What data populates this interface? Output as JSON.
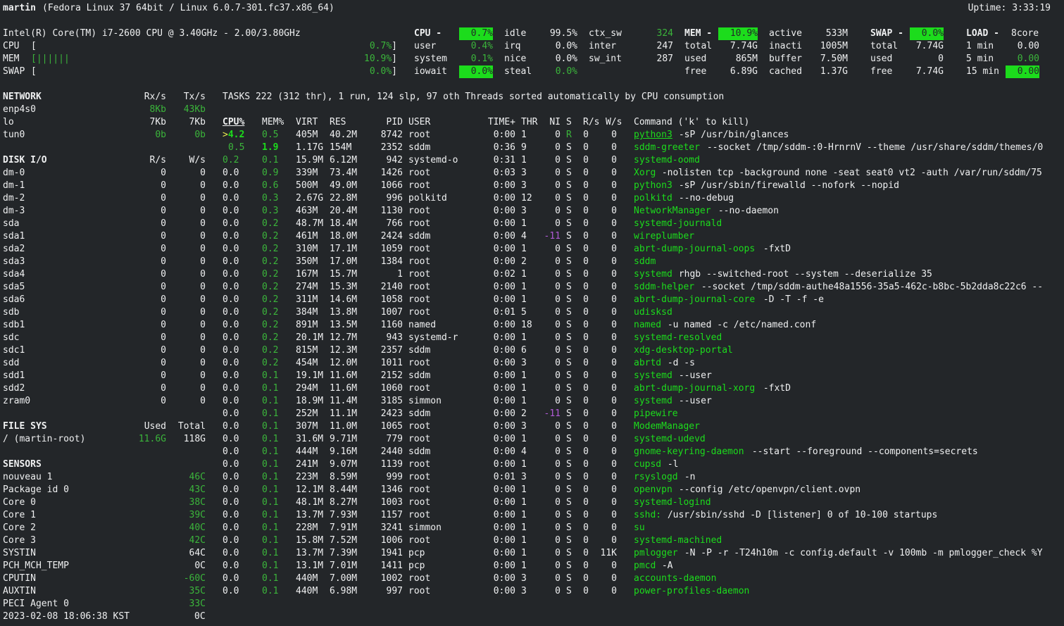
{
  "header": {
    "host": "martin",
    "sysinfo": "(Fedora Linux 37 64bit / Linux 6.0.7-301.fc37.x86_64)",
    "uptime": "Uptime: 3:33:19"
  },
  "quicklook": {
    "cpu_name": "Intel(R) Core(TM) i7-2600 CPU @ 3.40GHz - 2.00/3.80GHz",
    "bars": [
      {
        "label": "CPU",
        "bar": "[",
        "value": "0.7%]",
        "fraction": 0.007
      },
      {
        "label": "MEM",
        "bar": "[||||||",
        "value": "10.9%]",
        "fraction": 0.109
      },
      {
        "label": "SWAP",
        "bar": "[",
        "value": "0.0%]",
        "fraction": 0.0
      }
    ]
  },
  "cpu": {
    "title": "CPU -",
    "total": "0.7%",
    "rows": [
      {
        "k": "user",
        "v": "0.4%"
      },
      {
        "k": "system",
        "v": "0.1%"
      },
      {
        "k": "iowait",
        "v": "0.0%"
      }
    ],
    "rows2": [
      {
        "k": "idle",
        "v": "99.5%"
      },
      {
        "k": "irq",
        "v": "0.0%"
      },
      {
        "k": "nice",
        "v": "0.0%"
      },
      {
        "k": "steal",
        "v": "0.0%"
      }
    ],
    "rows3": [
      {
        "k": "ctx_sw",
        "v": "324"
      },
      {
        "k": "inter",
        "v": "247"
      },
      {
        "k": "sw_int",
        "v": "287"
      }
    ]
  },
  "mem": {
    "title": "MEM -",
    "total": "10.9%",
    "rows": [
      {
        "k": "total",
        "v": "7.74G"
      },
      {
        "k": "used",
        "v": "865M"
      },
      {
        "k": "free",
        "v": "6.89G"
      }
    ],
    "rows2": [
      {
        "k": "active",
        "v": "533M"
      },
      {
        "k": "inacti",
        "v": "1005M"
      },
      {
        "k": "buffer",
        "v": "7.50M"
      },
      {
        "k": "cached",
        "v": "1.37G"
      }
    ]
  },
  "swap": {
    "title": "SWAP -",
    "total": "0.0%",
    "rows": [
      {
        "k": "total",
        "v": "7.74G"
      },
      {
        "k": "used",
        "v": "0"
      },
      {
        "k": "free",
        "v": "7.74G"
      }
    ]
  },
  "load": {
    "title": "LOAD -",
    "cores": "8core",
    "rows": [
      {
        "k": "1 min",
        "v": "0.00"
      },
      {
        "k": "5 min",
        "v": "0.00"
      },
      {
        "k": "15 min",
        "v": "0.00"
      }
    ]
  },
  "network": {
    "title": "NETWORK",
    "rx": "Rx/s",
    "tx": "Tx/s",
    "rows": [
      {
        "name": "enp4s0",
        "rx": "8Kb",
        "tx": "43Kb"
      },
      {
        "name": "lo",
        "rx": "7Kb",
        "tx": "7Kb"
      },
      {
        "name": "tun0",
        "rx": "0b",
        "tx": "0b"
      }
    ]
  },
  "diskio": {
    "title": "DISK I/O",
    "r": "R/s",
    "w": "W/s",
    "rows": [
      {
        "name": "dm-0",
        "r": "0",
        "w": "0"
      },
      {
        "name": "dm-1",
        "r": "0",
        "w": "0"
      },
      {
        "name": "dm-2",
        "r": "0",
        "w": "0"
      },
      {
        "name": "dm-3",
        "r": "0",
        "w": "0"
      },
      {
        "name": "sda",
        "r": "0",
        "w": "0"
      },
      {
        "name": "sda1",
        "r": "0",
        "w": "0"
      },
      {
        "name": "sda2",
        "r": "0",
        "w": "0"
      },
      {
        "name": "sda3",
        "r": "0",
        "w": "0"
      },
      {
        "name": "sda4",
        "r": "0",
        "w": "0"
      },
      {
        "name": "sda5",
        "r": "0",
        "w": "0"
      },
      {
        "name": "sda6",
        "r": "0",
        "w": "0"
      },
      {
        "name": "sdb",
        "r": "0",
        "w": "0"
      },
      {
        "name": "sdb1",
        "r": "0",
        "w": "0"
      },
      {
        "name": "sdc",
        "r": "0",
        "w": "0"
      },
      {
        "name": "sdc1",
        "r": "0",
        "w": "0"
      },
      {
        "name": "sdd",
        "r": "0",
        "w": "0"
      },
      {
        "name": "sdd1",
        "r": "0",
        "w": "0"
      },
      {
        "name": "sdd2",
        "r": "0",
        "w": "0"
      },
      {
        "name": "zram0",
        "r": "0",
        "w": "0"
      }
    ]
  },
  "filesys": {
    "title": "FILE SYS",
    "used": "Used",
    "total": "Total",
    "rows": [
      {
        "name": "/ (martin-root)",
        "used": "11.6G",
        "total": "118G"
      }
    ]
  },
  "sensors": {
    "title": "SENSORS",
    "rows": [
      {
        "name": "nouveau 1",
        "v": "46C",
        "green": true
      },
      {
        "name": "Package id 0",
        "v": "43C",
        "green": true
      },
      {
        "name": "Core 0",
        "v": "38C",
        "green": true
      },
      {
        "name": "Core 1",
        "v": "39C",
        "green": true
      },
      {
        "name": "Core 2",
        "v": "40C",
        "green": true
      },
      {
        "name": "Core 3",
        "v": "42C",
        "green": true
      },
      {
        "name": "SYSTIN",
        "v": "64C",
        "green": false
      },
      {
        "name": "PCH_MCH_TEMP",
        "v": "0C",
        "green": false
      },
      {
        "name": "CPUTIN",
        "v": "-60C",
        "green": true
      },
      {
        "name": "AUXTIN",
        "v": "35C",
        "green": true
      },
      {
        "name": "PECI Agent 0",
        "v": "33C",
        "green": true
      }
    ]
  },
  "datetime": "2023-02-08 18:06:38 KST",
  "tasks": {
    "summary": "TASKS 222 (312 thr), 1 run, 124 slp, 97 oth Threads sorted automatically by CPU consumption",
    "headers": {
      "cpu": "CPU%",
      "mem": "MEM%",
      "virt": "VIRT",
      "res": "RES",
      "pid": "PID",
      "user": "USER",
      "time": "TIME+",
      "thr": "THR",
      "ni": "NI",
      "s": "S",
      "rs": "R/s",
      "ws": "W/s",
      "cmd": "Command ('k' to kill)"
    },
    "rows": [
      {
        "cpu": ">4.2",
        "mem": "0.5",
        "virt": "405M",
        "res": "40.2M",
        "pid": "8742",
        "user": "root",
        "time": "0:00",
        "thr": "1",
        "ni": "0",
        "s": "R",
        "r": "0",
        "w": "0",
        "name": "python3",
        "args": " -sP /usr/bin/glances"
      },
      {
        "cpu": "0.5",
        "mem": "1.9",
        "virt": "1.17G",
        "res": "154M",
        "pid": "2352",
        "user": "sddm",
        "time": "0:36",
        "thr": "9",
        "ni": "0",
        "s": "S",
        "r": "0",
        "w": "0",
        "name": "sddm-greeter",
        "args": " --socket /tmp/sddm-:0-HrnrnV --theme /usr/share/sddm/themes/0"
      },
      {
        "cpu": "0.2",
        "mem": "0.1",
        "virt": "15.9M",
        "res": "6.12M",
        "pid": "942",
        "user": "systemd-o",
        "time": "0:31",
        "thr": "1",
        "ni": "0",
        "s": "S",
        "r": "0",
        "w": "0",
        "name": "systemd-oomd",
        "args": ""
      },
      {
        "cpu": "0.0",
        "mem": "0.9",
        "virt": "339M",
        "res": "73.4M",
        "pid": "1426",
        "user": "root",
        "time": "0:03",
        "thr": "3",
        "ni": "0",
        "s": "S",
        "r": "0",
        "w": "0",
        "name": "Xorg",
        "args": " -nolisten tcp -background none -seat seat0 vt2 -auth /var/run/sddm/75"
      },
      {
        "cpu": "0.0",
        "mem": "0.6",
        "virt": "500M",
        "res": "49.0M",
        "pid": "1066",
        "user": "root",
        "time": "0:00",
        "thr": "3",
        "ni": "0",
        "s": "S",
        "r": "0",
        "w": "0",
        "name": "python3",
        "args": " -sP /usr/sbin/firewalld --nofork --nopid"
      },
      {
        "cpu": "0.0",
        "mem": "0.3",
        "virt": "2.67G",
        "res": "22.8M",
        "pid": "996",
        "user": "polkitd",
        "time": "0:00",
        "thr": "12",
        "ni": "0",
        "s": "S",
        "r": "0",
        "w": "0",
        "name": "polkitd",
        "args": " --no-debug"
      },
      {
        "cpu": "0.0",
        "mem": "0.3",
        "virt": "463M",
        "res": "20.4M",
        "pid": "1130",
        "user": "root",
        "time": "0:00",
        "thr": "3",
        "ni": "0",
        "s": "S",
        "r": "0",
        "w": "0",
        "name": "NetworkManager",
        "args": " --no-daemon"
      },
      {
        "cpu": "0.0",
        "mem": "0.2",
        "virt": "48.7M",
        "res": "18.4M",
        "pid": "766",
        "user": "root",
        "time": "0:00",
        "thr": "1",
        "ni": "0",
        "s": "S",
        "r": "0",
        "w": "0",
        "name": "systemd-journald",
        "args": ""
      },
      {
        "cpu": "0.0",
        "mem": "0.2",
        "virt": "461M",
        "res": "18.0M",
        "pid": "2424",
        "user": "sddm",
        "time": "0:00",
        "thr": "4",
        "ni": "-11",
        "s": "S",
        "r": "0",
        "w": "0",
        "name": "wireplumber",
        "args": ""
      },
      {
        "cpu": "0.0",
        "mem": "0.2",
        "virt": "310M",
        "res": "17.1M",
        "pid": "1059",
        "user": "root",
        "time": "0:00",
        "thr": "1",
        "ni": "0",
        "s": "S",
        "r": "0",
        "w": "0",
        "name": "abrt-dump-journal-oops",
        "args": " -fxtD"
      },
      {
        "cpu": "0.0",
        "mem": "0.2",
        "virt": "350M",
        "res": "17.0M",
        "pid": "1384",
        "user": "root",
        "time": "0:00",
        "thr": "2",
        "ni": "0",
        "s": "S",
        "r": "0",
        "w": "0",
        "name": "sddm",
        "args": ""
      },
      {
        "cpu": "0.0",
        "mem": "0.2",
        "virt": "167M",
        "res": "15.7M",
        "pid": "1",
        "user": "root",
        "time": "0:02",
        "thr": "1",
        "ni": "0",
        "s": "S",
        "r": "0",
        "w": "0",
        "name": "systemd",
        "args": " rhgb --switched-root --system --deserialize 35"
      },
      {
        "cpu": "0.0",
        "mem": "0.2",
        "virt": "274M",
        "res": "15.3M",
        "pid": "2140",
        "user": "root",
        "time": "0:00",
        "thr": "1",
        "ni": "0",
        "s": "S",
        "r": "0",
        "w": "0",
        "name": "sddm-helper",
        "args": " --socket /tmp/sddm-authe48a1556-35a5-462c-b8bc-5b2dda8c22c6 --"
      },
      {
        "cpu": "0.0",
        "mem": "0.2",
        "virt": "311M",
        "res": "14.6M",
        "pid": "1058",
        "user": "root",
        "time": "0:00",
        "thr": "1",
        "ni": "0",
        "s": "S",
        "r": "0",
        "w": "0",
        "name": "abrt-dump-journal-core",
        "args": " -D -T -f -e"
      },
      {
        "cpu": "0.0",
        "mem": "0.2",
        "virt": "384M",
        "res": "13.8M",
        "pid": "1007",
        "user": "root",
        "time": "0:01",
        "thr": "5",
        "ni": "0",
        "s": "S",
        "r": "0",
        "w": "0",
        "name": "udisksd",
        "args": ""
      },
      {
        "cpu": "0.0",
        "mem": "0.2",
        "virt": "891M",
        "res": "13.5M",
        "pid": "1160",
        "user": "named",
        "time": "0:00",
        "thr": "18",
        "ni": "0",
        "s": "S",
        "r": "0",
        "w": "0",
        "name": "named",
        "args": " -u named -c /etc/named.conf"
      },
      {
        "cpu": "0.0",
        "mem": "0.2",
        "virt": "20.1M",
        "res": "12.7M",
        "pid": "943",
        "user": "systemd-r",
        "time": "0:00",
        "thr": "1",
        "ni": "0",
        "s": "S",
        "r": "0",
        "w": "0",
        "name": "systemd-resolved",
        "args": ""
      },
      {
        "cpu": "0.0",
        "mem": "0.2",
        "virt": "815M",
        "res": "12.3M",
        "pid": "2357",
        "user": "sddm",
        "time": "0:00",
        "thr": "6",
        "ni": "0",
        "s": "S",
        "r": "0",
        "w": "0",
        "name": "xdg-desktop-portal",
        "args": ""
      },
      {
        "cpu": "0.0",
        "mem": "0.2",
        "virt": "454M",
        "res": "12.0M",
        "pid": "1011",
        "user": "root",
        "time": "0:00",
        "thr": "3",
        "ni": "0",
        "s": "S",
        "r": "0",
        "w": "0",
        "name": "abrtd",
        "args": " -d -s"
      },
      {
        "cpu": "0.0",
        "mem": "0.1",
        "virt": "19.1M",
        "res": "11.6M",
        "pid": "2152",
        "user": "sddm",
        "time": "0:00",
        "thr": "1",
        "ni": "0",
        "s": "S",
        "r": "0",
        "w": "0",
        "name": "systemd",
        "args": " --user"
      },
      {
        "cpu": "0.0",
        "mem": "0.1",
        "virt": "294M",
        "res": "11.6M",
        "pid": "1060",
        "user": "root",
        "time": "0:00",
        "thr": "1",
        "ni": "0",
        "s": "S",
        "r": "0",
        "w": "0",
        "name": "abrt-dump-journal-xorg",
        "args": " -fxtD"
      },
      {
        "cpu": "0.0",
        "mem": "0.1",
        "virt": "18.9M",
        "res": "11.4M",
        "pid": "3185",
        "user": "simmon",
        "time": "0:00",
        "thr": "1",
        "ni": "0",
        "s": "S",
        "r": "0",
        "w": "0",
        "name": "systemd",
        "args": " --user"
      },
      {
        "cpu": "0.0",
        "mem": "0.1",
        "virt": "252M",
        "res": "11.1M",
        "pid": "2423",
        "user": "sddm",
        "time": "0:00",
        "thr": "2",
        "ni": "-11",
        "s": "S",
        "r": "0",
        "w": "0",
        "name": "pipewire",
        "args": ""
      },
      {
        "cpu": "0.0",
        "mem": "0.1",
        "virt": "307M",
        "res": "11.0M",
        "pid": "1065",
        "user": "root",
        "time": "0:00",
        "thr": "3",
        "ni": "0",
        "s": "S",
        "r": "0",
        "w": "0",
        "name": "ModemManager",
        "args": ""
      },
      {
        "cpu": "0.0",
        "mem": "0.1",
        "virt": "31.6M",
        "res": "9.71M",
        "pid": "779",
        "user": "root",
        "time": "0:00",
        "thr": "1",
        "ni": "0",
        "s": "S",
        "r": "0",
        "w": "0",
        "name": "systemd-udevd",
        "args": ""
      },
      {
        "cpu": "0.0",
        "mem": "0.1",
        "virt": "444M",
        "res": "9.16M",
        "pid": "2440",
        "user": "sddm",
        "time": "0:00",
        "thr": "4",
        "ni": "0",
        "s": "S",
        "r": "0",
        "w": "0",
        "name": "gnome-keyring-daemon",
        "args": " --start --foreground --components=secrets"
      },
      {
        "cpu": "0.0",
        "mem": "0.1",
        "virt": "241M",
        "res": "9.07M",
        "pid": "1139",
        "user": "root",
        "time": "0:00",
        "thr": "1",
        "ni": "0",
        "s": "S",
        "r": "0",
        "w": "0",
        "name": "cupsd",
        "args": " -l"
      },
      {
        "cpu": "0.0",
        "mem": "0.1",
        "virt": "223M",
        "res": "8.59M",
        "pid": "999",
        "user": "root",
        "time": "0:01",
        "thr": "3",
        "ni": "0",
        "s": "S",
        "r": "0",
        "w": "0",
        "name": "rsyslogd",
        "args": " -n"
      },
      {
        "cpu": "0.0",
        "mem": "0.1",
        "virt": "12.1M",
        "res": "8.44M",
        "pid": "1346",
        "user": "root",
        "time": "0:00",
        "thr": "1",
        "ni": "0",
        "s": "S",
        "r": "0",
        "w": "0",
        "name": "openvpn",
        "args": " --config /etc/openvpn/client.ovpn"
      },
      {
        "cpu": "0.0",
        "mem": "0.1",
        "virt": "48.1M",
        "res": "8.27M",
        "pid": "1003",
        "user": "root",
        "time": "0:00",
        "thr": "1",
        "ni": "0",
        "s": "S",
        "r": "0",
        "w": "0",
        "name": "systemd-logind",
        "args": ""
      },
      {
        "cpu": "0.0",
        "mem": "0.1",
        "virt": "13.7M",
        "res": "7.93M",
        "pid": "1157",
        "user": "root",
        "time": "0:00",
        "thr": "1",
        "ni": "0",
        "s": "S",
        "r": "0",
        "w": "0",
        "name": "sshd:",
        "args": " /usr/sbin/sshd -D [listener] 0 of 10-100 startups"
      },
      {
        "cpu": "0.0",
        "mem": "0.1",
        "virt": "228M",
        "res": "7.91M",
        "pid": "3241",
        "user": "simmon",
        "time": "0:00",
        "thr": "1",
        "ni": "0",
        "s": "S",
        "r": "0",
        "w": "0",
        "name": "su",
        "args": ""
      },
      {
        "cpu": "0.0",
        "mem": "0.1",
        "virt": "15.8M",
        "res": "7.52M",
        "pid": "1006",
        "user": "root",
        "time": "0:00",
        "thr": "1",
        "ni": "0",
        "s": "S",
        "r": "0",
        "w": "0",
        "name": "systemd-machined",
        "args": ""
      },
      {
        "cpu": "0.0",
        "mem": "0.1",
        "virt": "13.7M",
        "res": "7.39M",
        "pid": "1941",
        "user": "pcp",
        "time": "0:00",
        "thr": "1",
        "ni": "0",
        "s": "S",
        "r": "0",
        "w": "11K",
        "name": "pmlogger",
        "args": " -N -P -r -T24h10m -c config.default -v 100mb -m pmlogger_check %Y"
      },
      {
        "cpu": "0.0",
        "mem": "0.1",
        "virt": "13.1M",
        "res": "7.01M",
        "pid": "1411",
        "user": "pcp",
        "time": "0:00",
        "thr": "1",
        "ni": "0",
        "s": "S",
        "r": "0",
        "w": "0",
        "name": "pmcd",
        "args": " -A"
      },
      {
        "cpu": "0.0",
        "mem": "0.1",
        "virt": "440M",
        "res": "7.00M",
        "pid": "1002",
        "user": "root",
        "time": "0:00",
        "thr": "3",
        "ni": "0",
        "s": "S",
        "r": "0",
        "w": "0",
        "name": "accounts-daemon",
        "args": ""
      },
      {
        "cpu": "0.0",
        "mem": "0.1",
        "virt": "440M",
        "res": "6.98M",
        "pid": "997",
        "user": "root",
        "time": "0:00",
        "thr": "3",
        "ni": "0",
        "s": "S",
        "r": "0",
        "w": "0",
        "name": "power-profiles-daemon",
        "args": ""
      }
    ]
  }
}
